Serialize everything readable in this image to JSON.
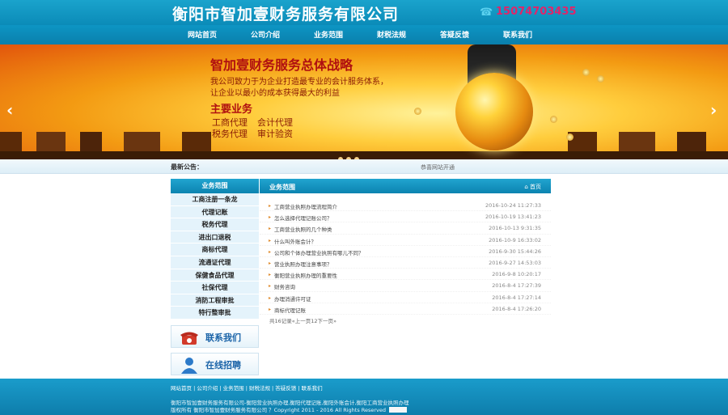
{
  "header": {
    "logo": "衡阳市智加壹财务服务有限公司",
    "phone": "15074703435"
  },
  "nav": [
    {
      "label": "网站首页"
    },
    {
      "label": "公司介绍"
    },
    {
      "label": "业务范围"
    },
    {
      "label": "财税法规"
    },
    {
      "label": "答疑反馈"
    },
    {
      "label": "联系我们"
    }
  ],
  "banner": {
    "title": "智加壹财务服务总体战略",
    "line1": "我公司致力于为企业打造最专业的会计服务体系，",
    "line2": "让企业以最小的成本获得最大的利益",
    "main_title": "主要业务",
    "services": [
      "工商代理",
      "会计代理",
      "税务代理",
      "审计验资"
    ]
  },
  "notice": {
    "label": "最新公告：",
    "text": "恭喜网站开通"
  },
  "sidebar": {
    "title": "业务范围",
    "items": [
      "工商注册一条龙",
      "代理记账",
      "税务代理",
      "进出口退税",
      "商标代理",
      "流通证代理",
      "保健食品代理",
      "社保代理",
      "消防工程审批",
      "特行整审批"
    ]
  },
  "promos": {
    "contact": "联系我们",
    "jobs": "在线招聘"
  },
  "main": {
    "title": "业务范围",
    "home_link": "首页",
    "articles": [
      {
        "title": "工商营业执照办理流程简介",
        "date": "2016-10-24 11:27:33"
      },
      {
        "title": "怎么选择代理记账公司？",
        "date": "2016-10-19 13:41:23"
      },
      {
        "title": "工商营业执照的几个种类",
        "date": "2016-10-13 9:31:35"
      },
      {
        "title": "什么叫外账会计？",
        "date": "2016-10-9 16:33:02"
      },
      {
        "title": "公司和个体办理营业执照有哪儿不同？",
        "date": "2016-9-30 15:44:26"
      },
      {
        "title": "营业执照办理注意事项？",
        "date": "2016-9-27 14:53:03"
      },
      {
        "title": "衡阳营业执照办理的重要性",
        "date": "2016-9-8 10:20:17"
      },
      {
        "title": "财务咨询",
        "date": "2016-8-4 17:27:39"
      },
      {
        "title": "办理消通许可证",
        "date": "2016-8-4 17:27:14"
      },
      {
        "title": "商标代理记账",
        "date": "2016-8-4 17:26:20"
      }
    ],
    "pager": "共16记录«上一页12下一页»"
  },
  "footer": {
    "links": "网站首页 | 公司介绍 | 业务范围 | 财税法规 | 答疑反馈 | 联系我们",
    "line1": "衡阳市智加壹财务服务有限公司-衡阳营业执照办理,衡阳代理记账,衡阳外账会计,衡阳工商营业执照办理",
    "line2": "版权所有 衡阳市智加壹财务服务有限公司 ？Copyright 2011 - 2016 All Rights Reserved"
  },
  "colors": {
    "brand": "#0b8bb8",
    "title_red": "#b01010",
    "phone": "#e0256a"
  }
}
